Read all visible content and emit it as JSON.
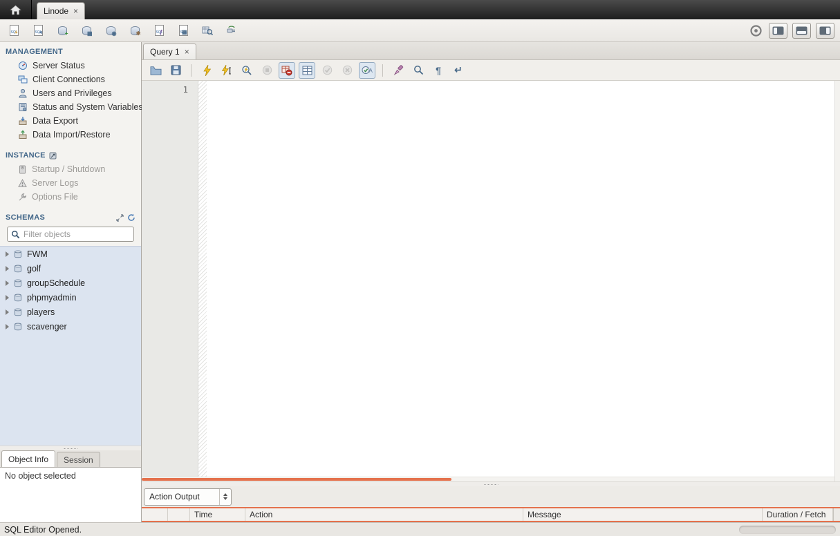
{
  "window": {
    "home_tab_icon": "home-icon",
    "document_tabs": [
      {
        "label": "Linode",
        "close": "×"
      }
    ]
  },
  "main_toolbar": {
    "left_icons": [
      "new-query-tab-icon",
      "open-sql-script-icon",
      "create-schema-icon",
      "create-table-icon",
      "create-view-icon",
      "create-procedure-icon",
      "create-function-icon",
      "new-script-icon",
      "search-table-data-icon",
      "reconnect-dbms-icon"
    ],
    "right_icons": [
      "activity-indicator-icon",
      "toggle-left-sidebar-icon",
      "toggle-output-area-icon",
      "toggle-right-sidebar-icon"
    ]
  },
  "sidebar": {
    "management": {
      "title": "MANAGEMENT",
      "items": [
        "Server Status",
        "Client Connections",
        "Users and Privileges",
        "Status and System Variables",
        "Data Export",
        "Data Import/Restore"
      ]
    },
    "instance": {
      "title": "INSTANCE",
      "items": [
        "Startup / Shutdown",
        "Server Logs",
        "Options File"
      ]
    },
    "schemas_section": {
      "title": "SCHEMAS",
      "filter_placeholder": "Filter objects",
      "schemas": [
        "FWM",
        "golf",
        "groupSchedule",
        "phpmyadmin",
        "players",
        "scavenger"
      ]
    },
    "bottom_tabs": {
      "object_info": "Object Info",
      "session": "Session"
    },
    "object_info_text": "No object selected"
  },
  "editor": {
    "tab": {
      "label": "Query 1",
      "close": "×"
    },
    "line_number": "1",
    "toolbar_icons": [
      "open-file-icon",
      "save-icon",
      "execute-icon",
      "execute-current-icon",
      "explain-icon",
      "stop-icon",
      "stop-on-error-toggle-icon",
      "limit-rows-toggle-icon",
      "commit-icon",
      "rollback-icon",
      "autocommit-toggle-icon",
      "beautify-icon",
      "find-icon",
      "invisible-chars-icon",
      "wrap-text-icon"
    ]
  },
  "output": {
    "selector_value": "Action Output",
    "columns": [
      "Time",
      "Action",
      "Message",
      "Duration / Fetch"
    ]
  },
  "statusbar": {
    "message": "SQL Editor Opened."
  },
  "colors": {
    "accent_orange": "#e4714d",
    "schema_panel_blue": "#dce4f0",
    "section_header_blue": "#44688a",
    "titlebar_dark": "#2b2b2b"
  }
}
